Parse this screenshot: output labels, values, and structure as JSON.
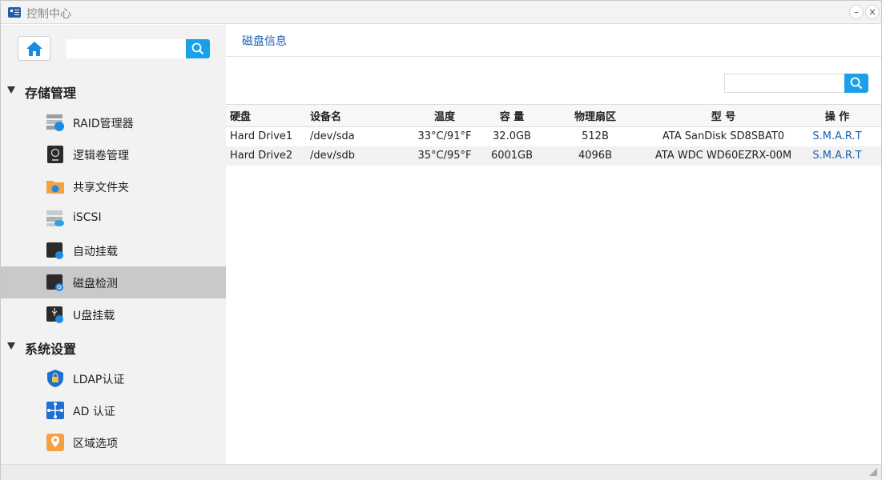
{
  "window": {
    "title": "控制中心"
  },
  "sidebar": {
    "search_placeholder": "",
    "groups": [
      {
        "label": "存储管理",
        "items": [
          {
            "label": "RAID管理器",
            "icon": "raid-manager-icon"
          },
          {
            "label": "逻辑卷管理",
            "icon": "logical-volume-icon"
          },
          {
            "label": "共享文件夹",
            "icon": "shared-folder-icon"
          },
          {
            "label": "iSCSI",
            "icon": "iscsi-icon"
          },
          {
            "label": "自动挂载",
            "icon": "auto-mount-icon"
          },
          {
            "label": "磁盘检测",
            "icon": "disk-check-icon",
            "active": true
          },
          {
            "label": "U盘挂载",
            "icon": "usb-mount-icon"
          }
        ]
      },
      {
        "label": "系统设置",
        "items": [
          {
            "label": "LDAP认证",
            "icon": "ldap-shield-icon"
          },
          {
            "label": "AD 认证",
            "icon": "ad-network-icon"
          },
          {
            "label": "区域选项",
            "icon": "region-pin-icon"
          }
        ]
      }
    ]
  },
  "main": {
    "tab_label": "磁盘信息",
    "search_placeholder": "",
    "table": {
      "headers": [
        "硬盘",
        "设备名",
        "温度",
        "容 量",
        "物理扇区",
        "型 号",
        "操 作"
      ],
      "rows": [
        {
          "disk": "Hard Drive1",
          "device": "/dev/sda",
          "temp": "33°C/91°F",
          "capacity": "32.0GB",
          "sector": "512B",
          "model": "ATA SanDisk SD8SBAT0",
          "action": "S.M.A.R.T"
        },
        {
          "disk": "Hard Drive2",
          "device": "/dev/sdb",
          "temp": "35°C/95°F",
          "capacity": "6001GB",
          "sector": "4096B",
          "model": "ATA WDC WD60EZRX-00M",
          "action": "S.M.A.R.T"
        }
      ]
    }
  },
  "colors": {
    "accent": "#1aa0e8",
    "link": "#1a5fb4",
    "active_row": "#c9c9c9"
  }
}
